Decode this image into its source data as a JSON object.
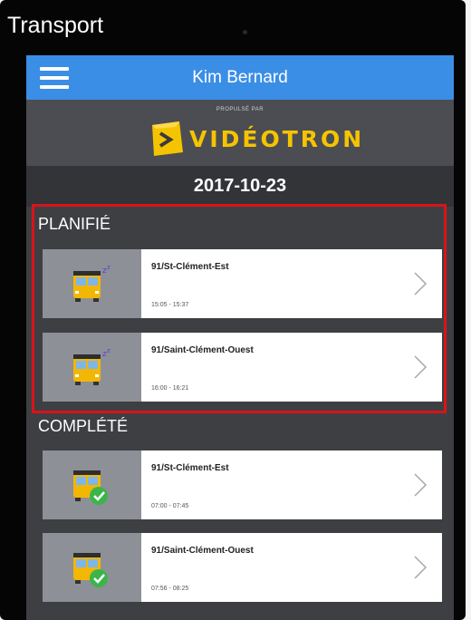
{
  "window": {
    "title": "Transport"
  },
  "app": {
    "user_name": "Kim Bernard",
    "menu_icon": "hamburger-menu-icon",
    "accent_color": "#3a8ee6"
  },
  "brand": {
    "powered_by": "PROPULSÉ PAR",
    "name": "VIDÉOTRON",
    "logo_icon": "videotron-logo",
    "color": "#f5c400"
  },
  "date": "2017-10-23",
  "highlight_color": "#d7141a",
  "sections": {
    "planned": {
      "title": "PLANIFIÉ",
      "trips": [
        {
          "route": "91/St-Clément-Est",
          "times": "15:05 - 15:37",
          "icon": "sleeping-bus-icon"
        },
        {
          "route": "91/Saint-Clément-Ouest",
          "times": "16:00 - 16:21",
          "icon": "sleeping-bus-icon"
        }
      ]
    },
    "completed": {
      "title": "COMPLÉTÉ",
      "trips": [
        {
          "route": "91/St-Clément-Est",
          "times": "07:00 - 07:45",
          "icon": "bus-completed-icon"
        },
        {
          "route": "91/Saint-Clément-Ouest",
          "times": "07:56 - 08:25",
          "icon": "bus-completed-icon"
        }
      ]
    }
  }
}
